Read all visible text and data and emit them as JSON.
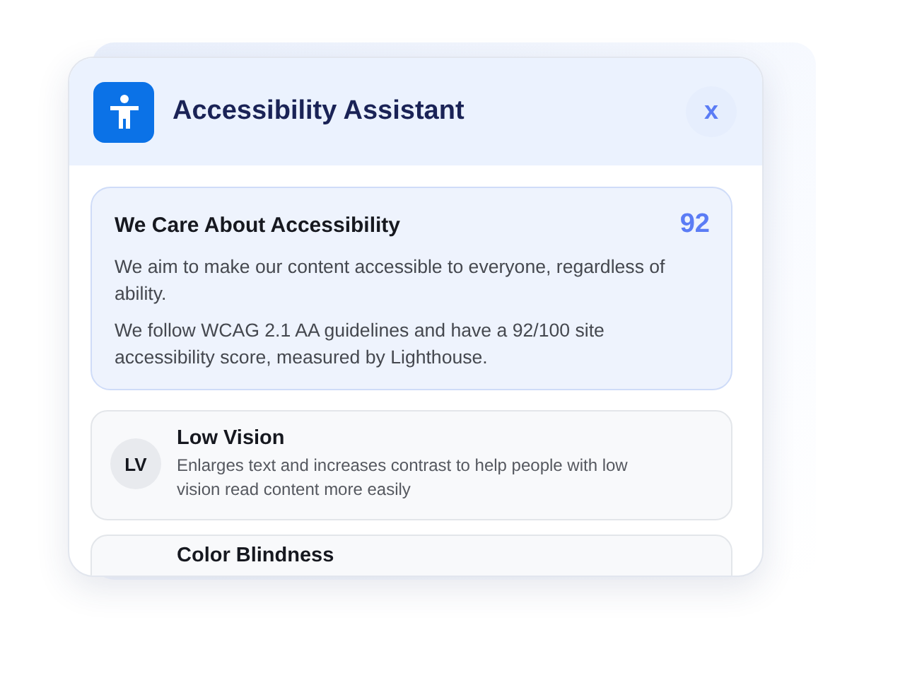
{
  "panel": {
    "title": "Accessibility Assistant",
    "close_label": "x"
  },
  "intro": {
    "title": "We Care About Accessibility",
    "score": "92",
    "paragraphs": [
      "We aim to make our content accessible to everyone, regardless of ability.",
      "We follow WCAG 2.1 AA guidelines and have a 92/100 site accessibility score, measured by Lighthouse."
    ]
  },
  "profiles": [
    {
      "badge": "LV",
      "name": "Low Vision",
      "description": "Enlarges text and increases contrast to help people with low vision read content more easily"
    },
    {
      "name": "Color Blindness"
    }
  ]
}
